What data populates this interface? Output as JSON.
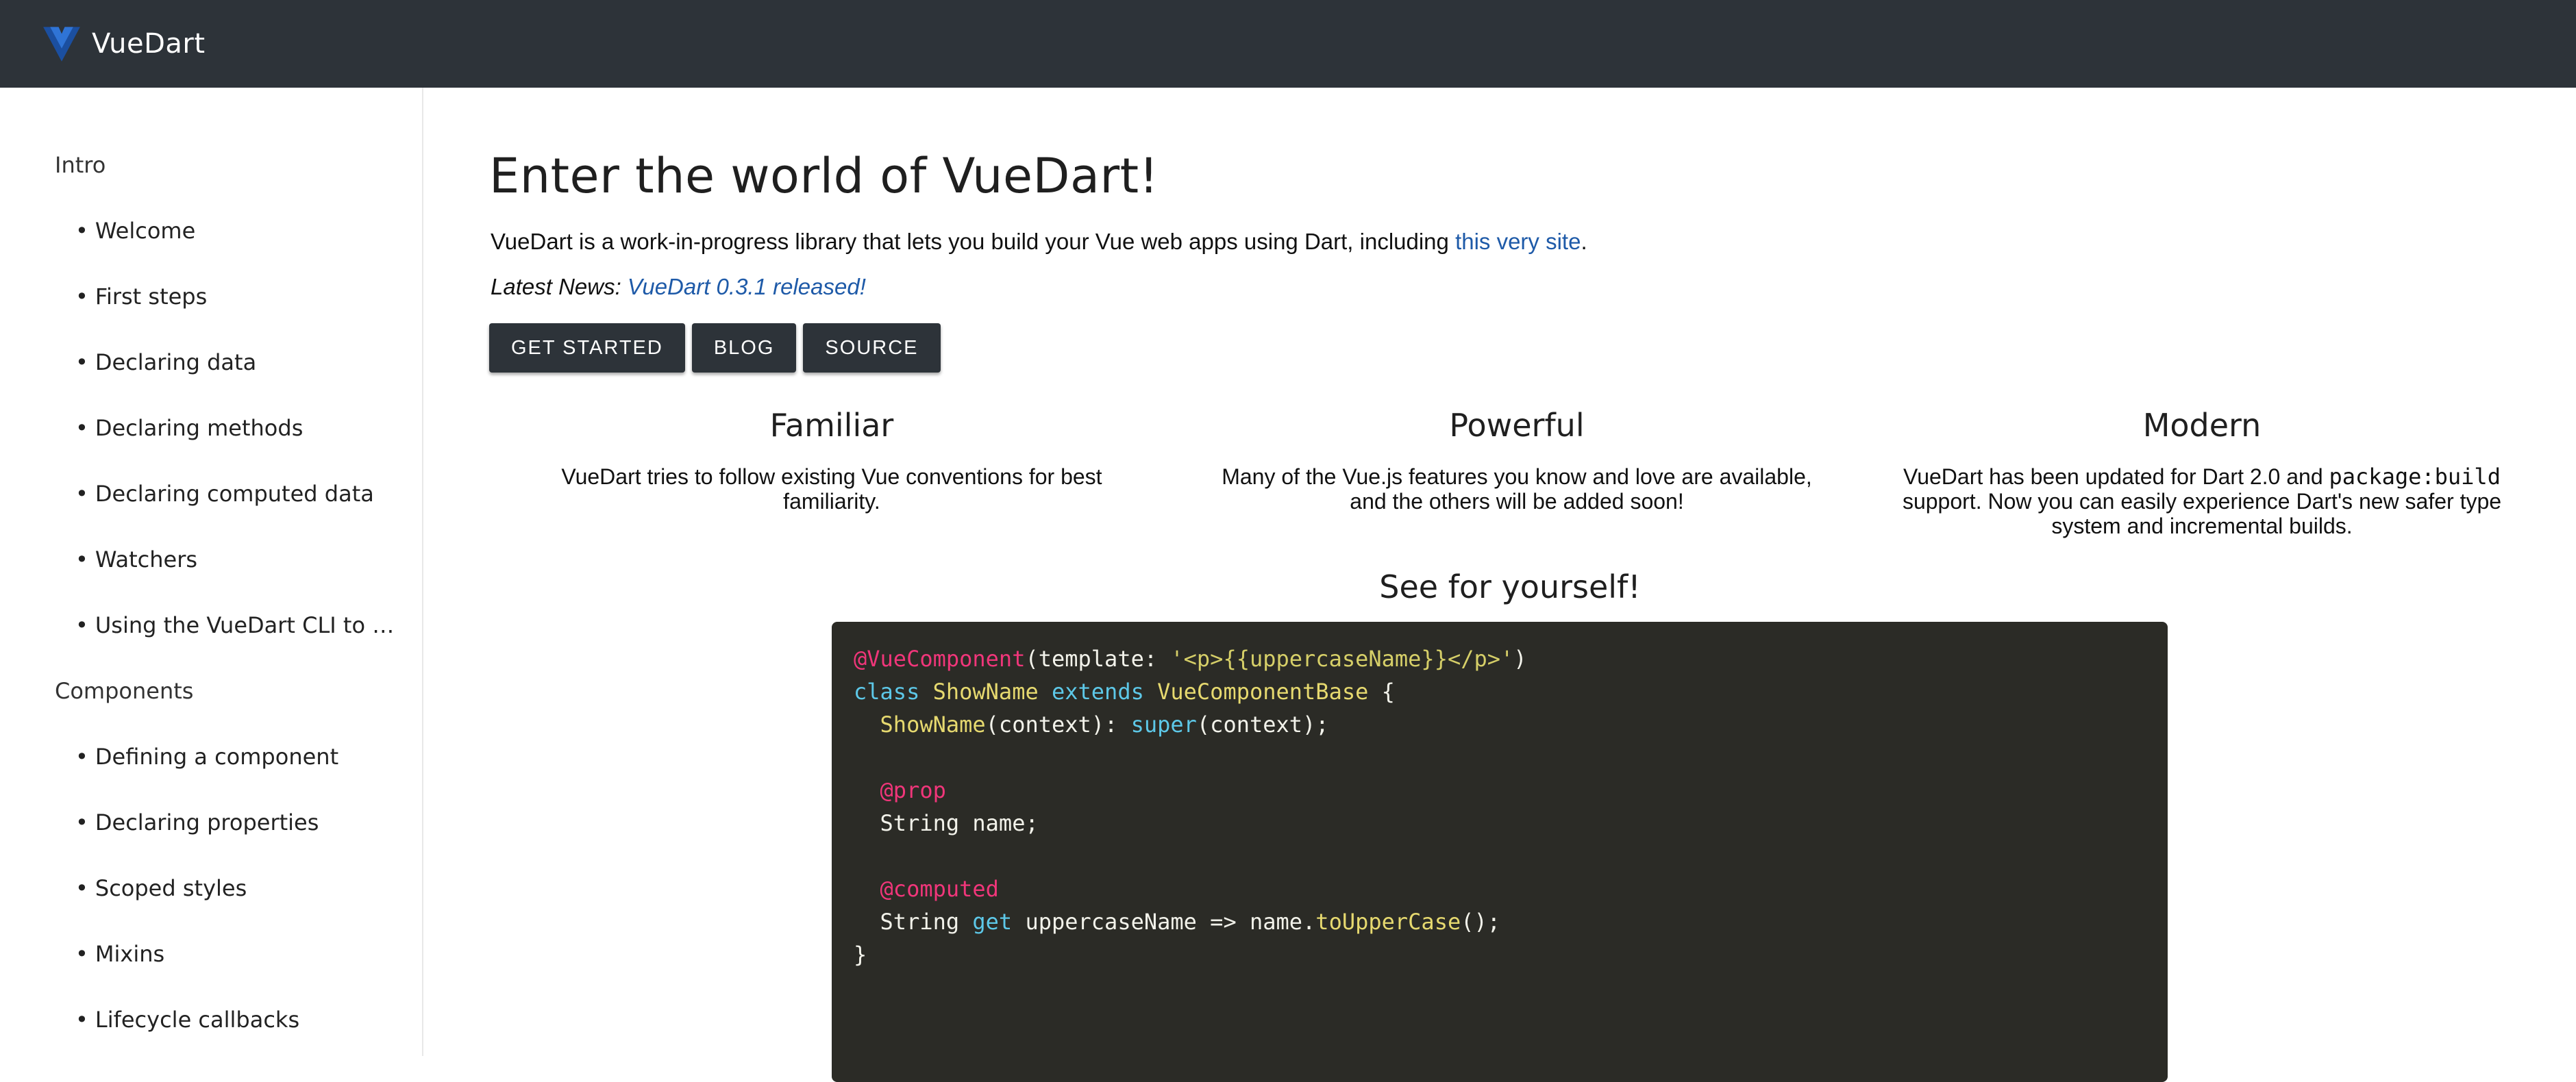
{
  "app": {
    "brand": "VueDart",
    "accent_color": "#2d3339",
    "logo_icon": "vuedart-logo-icon"
  },
  "sidebar": {
    "sections": [
      {
        "title": "Intro",
        "items": [
          "Welcome",
          "First steps",
          "Declaring data",
          "Declaring methods",
          "Declaring computed data",
          "Watchers",
          "Using the VueDart CLI to create a project"
        ]
      },
      {
        "title": "Components",
        "items": [
          "Defining a component",
          "Declaring properties",
          "Scoped styles",
          "Mixins",
          "Lifecycle callbacks"
        ]
      }
    ]
  },
  "main": {
    "title": "Enter the world of VueDart!",
    "intro_text": "VueDart is a work-in-progress library that lets you build your Vue web apps using Dart, including ",
    "intro_link": "this very site",
    "intro_end": ".",
    "news_label": "Latest News: ",
    "news_link": "VueDart 0.3.1 released!",
    "buttons": {
      "get_started": "GET STARTED",
      "blog": "BLOG",
      "source": "SOURCE"
    },
    "features": [
      {
        "title": "Familiar",
        "text": "VueDart tries to follow existing Vue conventions for best familiarity."
      },
      {
        "title": "Powerful",
        "text": "Many of the Vue.js features you know and love are available, and the others will be added soon!"
      },
      {
        "title": "Modern",
        "text_before": "VueDart has been updated for Dart 2.0 and ",
        "text_code": "package:build",
        "text_after": " support. Now you can easily experience Dart's new safer type system and incremental builds."
      }
    ],
    "see_title": "See for yourself!",
    "code_lines": [
      [
        {
          "t": "@VueComponent",
          "c": "ann"
        },
        {
          "t": "(template: ",
          "c": "plain"
        },
        {
          "t": "'<p>{{uppercaseName}}</p>'",
          "c": "str"
        },
        {
          "t": ")",
          "c": "plain"
        }
      ],
      [
        {
          "t": "class ",
          "c": "kw"
        },
        {
          "t": "ShowName ",
          "c": "cls"
        },
        {
          "t": "extends ",
          "c": "kw"
        },
        {
          "t": "VueComponentBase",
          "c": "cls"
        },
        {
          "t": " {",
          "c": "plain"
        }
      ],
      [
        {
          "t": "  ",
          "c": "plain"
        },
        {
          "t": "ShowName",
          "c": "cls"
        },
        {
          "t": "(context): ",
          "c": "plain"
        },
        {
          "t": "super",
          "c": "kw"
        },
        {
          "t": "(context);",
          "c": "plain"
        }
      ],
      [],
      [
        {
          "t": "  ",
          "c": "plain"
        },
        {
          "t": "@prop",
          "c": "ann"
        }
      ],
      [
        {
          "t": "  String name;",
          "c": "plain"
        }
      ],
      [],
      [
        {
          "t": "  ",
          "c": "plain"
        },
        {
          "t": "@computed",
          "c": "ann"
        }
      ],
      [
        {
          "t": "  String ",
          "c": "plain"
        },
        {
          "t": "get",
          "c": "kw"
        },
        {
          "t": " uppercaseName => name.",
          "c": "plain"
        },
        {
          "t": "toUpperCase",
          "c": "cls"
        },
        {
          "t": "();",
          "c": "plain"
        }
      ],
      [
        {
          "t": "}",
          "c": "plain"
        }
      ]
    ]
  }
}
